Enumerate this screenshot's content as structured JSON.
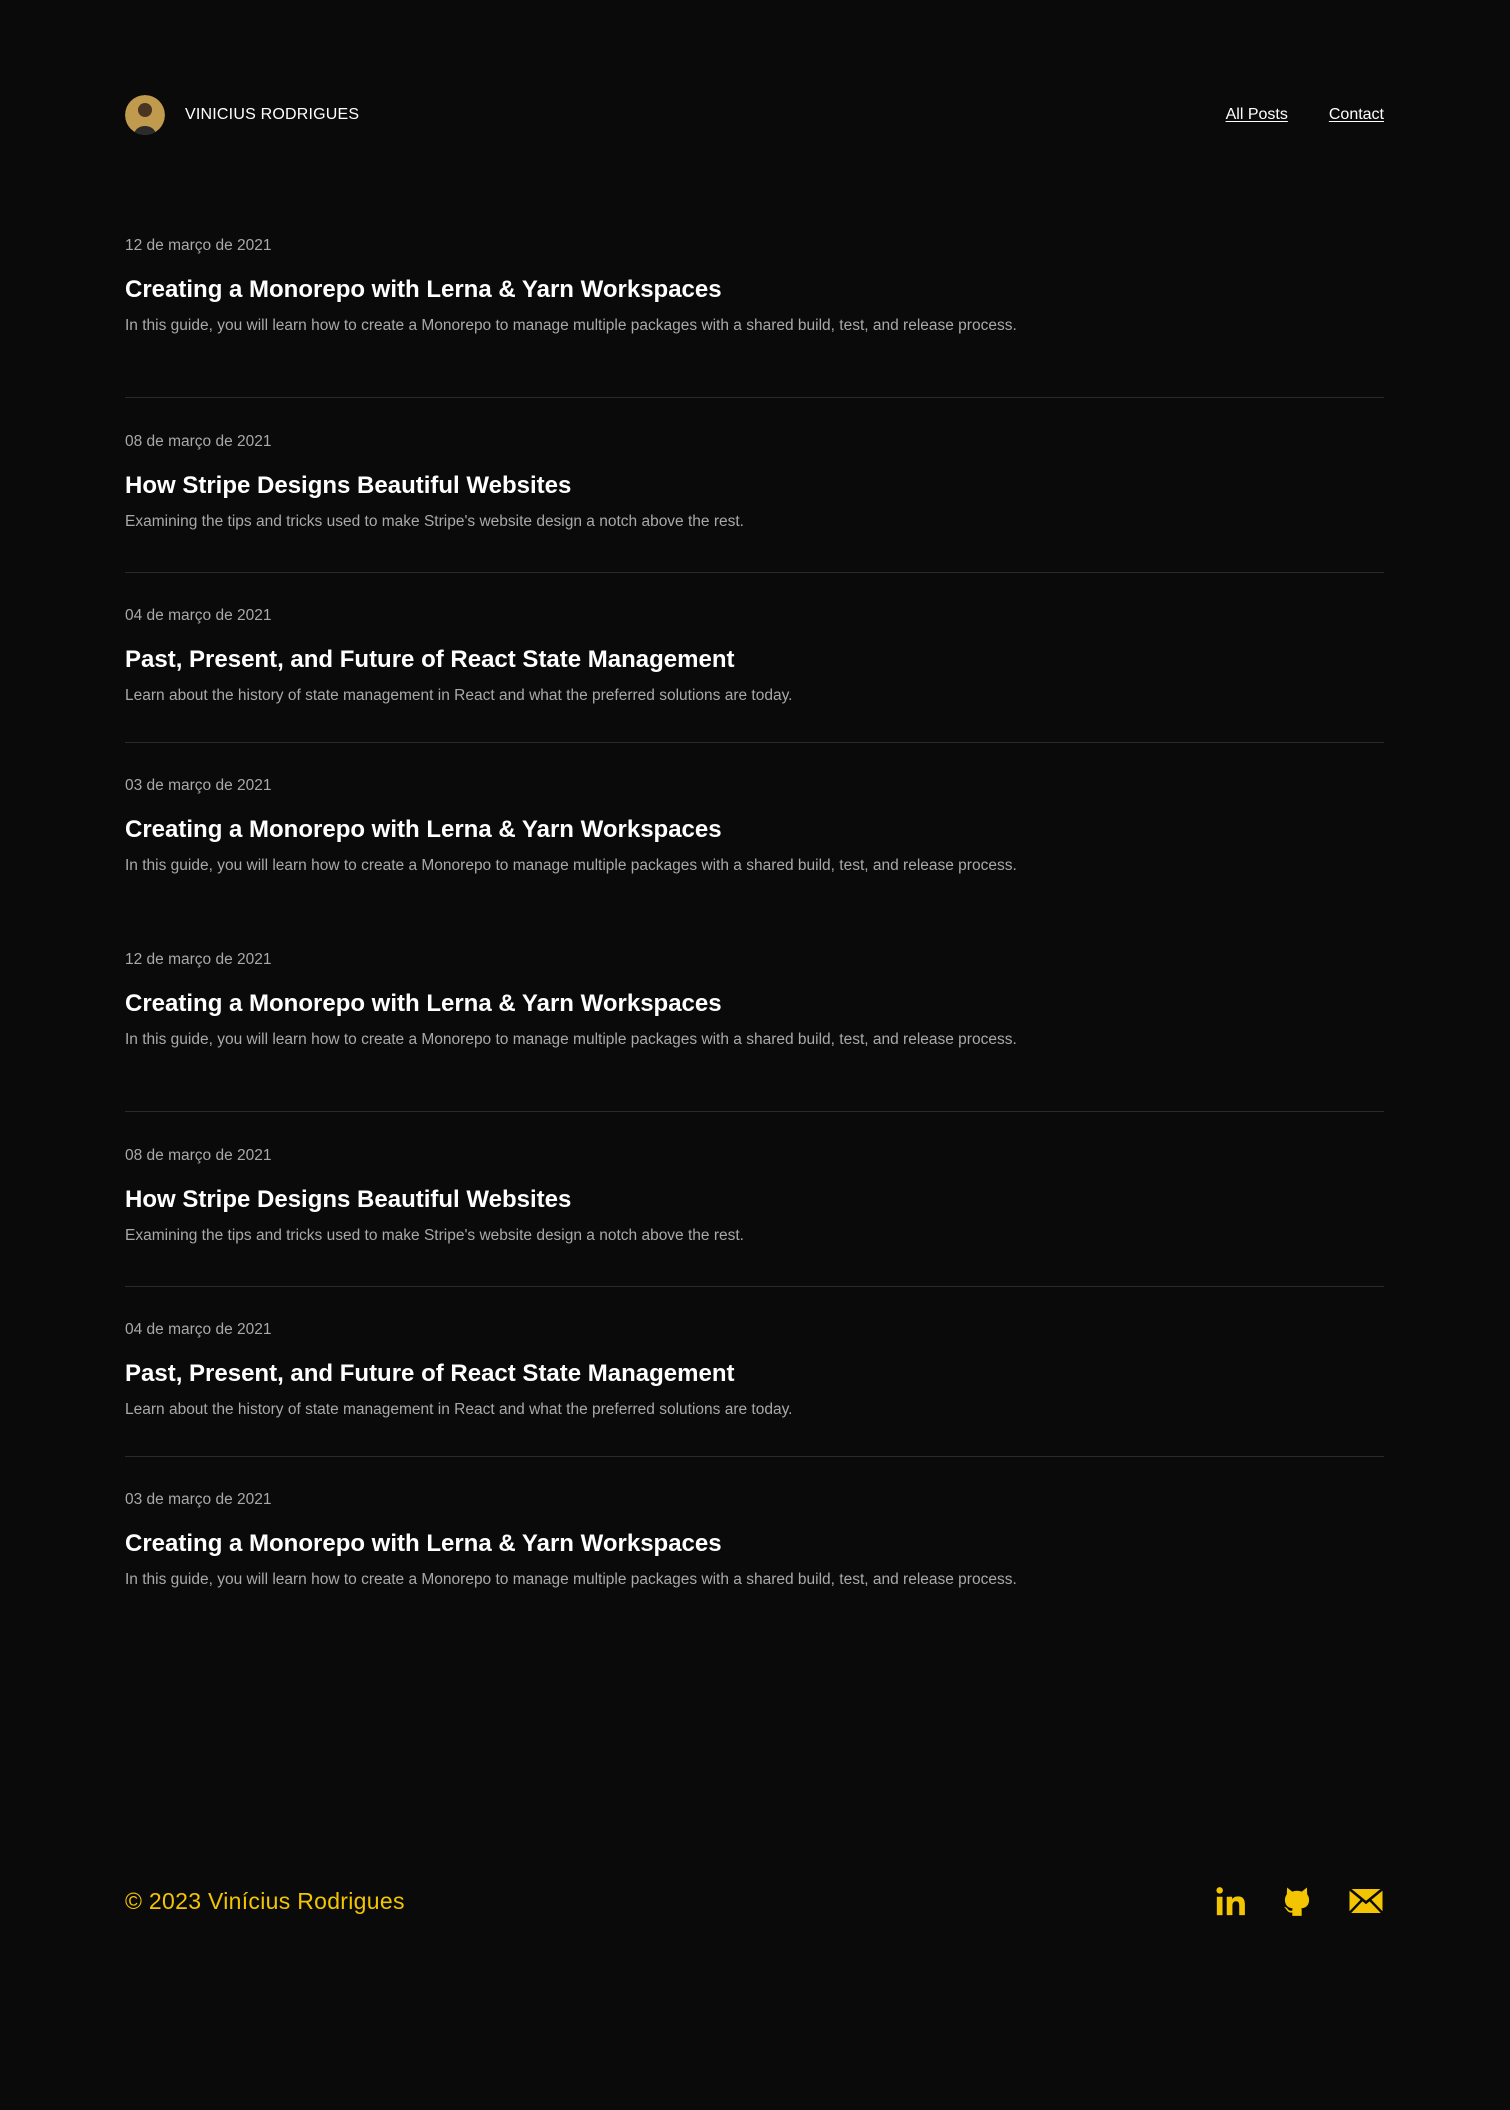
{
  "header": {
    "brand_name": "VINICIUS RODRIGUES",
    "nav": {
      "all_posts": "All Posts",
      "contact": "Contact"
    }
  },
  "posts": [
    {
      "date": "12 de março de 2021",
      "title": "Creating a Monorepo with Lerna & Yarn Workspaces",
      "description": "In this guide, you will learn how to create a Monorepo to manage multiple packages with a shared build, test, and release process."
    },
    {
      "date": "08 de março de 2021",
      "title": "How Stripe Designs Beautiful Websites",
      "description": "Examining the tips and tricks used to make Stripe's website design a notch above the rest."
    },
    {
      "date": "04 de março de 2021",
      "title": "Past, Present, and Future of React State Management",
      "description": "Learn about the history of state management in React and what the preferred solutions are today."
    },
    {
      "date": "03 de março de 2021",
      "title": "Creating a Monorepo with Lerna & Yarn Workspaces",
      "description": "In this guide, you will learn how to create a Monorepo to manage multiple packages with a shared build, test, and release process."
    },
    {
      "date": "12 de março de 2021",
      "title": "Creating a Monorepo with Lerna & Yarn Workspaces",
      "description": "In this guide, you will learn how to create a Monorepo to manage multiple packages with a shared build, test, and release process."
    },
    {
      "date": "08 de março de 2021",
      "title": "How Stripe Designs Beautiful Websites",
      "description": "Examining the tips and tricks used to make Stripe's website design a notch above the rest."
    },
    {
      "date": "04 de março de 2021",
      "title": "Past, Present, and Future of React State Management",
      "description": "Learn about the history of state management in React and what the preferred solutions are today."
    },
    {
      "date": "03 de março de 2021",
      "title": "Creating a Monorepo with Lerna & Yarn Workspaces",
      "description": "In this guide, you will learn how to create a Monorepo to manage multiple packages with a shared build, test, and release process."
    }
  ],
  "footer": {
    "copyright": "© 2023 Vinícius Rodrigues",
    "social_icons": [
      "linkedin-icon",
      "github-icon",
      "mail-icon"
    ]
  },
  "colors": {
    "background": "#0a0a0a",
    "accent": "#f2c500",
    "muted_text": "#a9a9a9",
    "divider": "#2a2a2a"
  }
}
